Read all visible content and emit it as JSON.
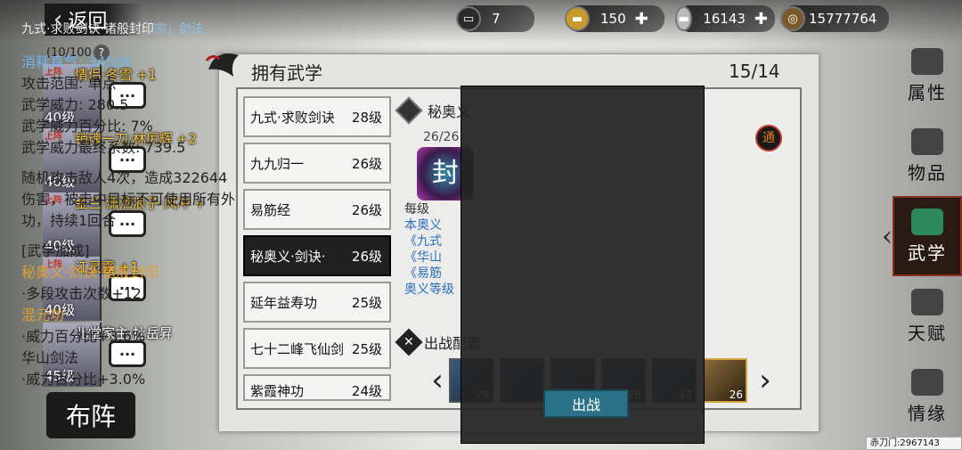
{
  "topbar": {
    "back_label": "返回",
    "resources": [
      {
        "icon": "cart-icon",
        "value": "7",
        "has_plus": false
      },
      {
        "icon": "gold-ingot-icon",
        "value": "150",
        "has_plus": true
      },
      {
        "icon": "silver-ingot-icon",
        "value": "16143",
        "has_plus": true
      },
      {
        "icon": "coin-icon",
        "value": "15777764",
        "has_plus": false
      }
    ]
  },
  "roster": {
    "count": "(10/100",
    "help": "?",
    "heroes": [
      {
        "deploy": "上阵",
        "name": "情侣·冬雪 +1",
        "level": "40级"
      },
      {
        "deploy": "上阵",
        "name": "销魂一刀·林厉辉 +2",
        "level": "40级"
      },
      {
        "deploy": "上阵",
        "name": "金兰·潇洒浪子·风冲 +",
        "level": "40级"
      },
      {
        "deploy": "上阵",
        "name": "江灵露 +1",
        "level": "40级"
      },
      {
        "deploy": "",
        "name": "北堂家主·杜岳昇",
        "level": "45级"
      }
    ],
    "chat_glyph": "···",
    "formation_label": "布阵"
  },
  "panel": {
    "title": "拥有武学",
    "page": "15/14",
    "skills": [
      {
        "name": "九式·求败剑诀",
        "level": "28级"
      },
      {
        "name": "九九归一",
        "level": "26级"
      },
      {
        "name": "易筋经",
        "level": "26级"
      },
      {
        "name": "秘奥义·剑诀·",
        "level": "26级"
      },
      {
        "name": "延年益寿功",
        "level": "25级"
      },
      {
        "name": "七十二峰飞仙剑",
        "level": "25级"
      },
      {
        "name": "紫霞神功",
        "level": "24级"
      }
    ],
    "detail": {
      "name": "秘奥义",
      "progress": "26/26",
      "art_char": "封",
      "tong": "通",
      "lines": [
        {
          "text": "每级",
          "cls": ""
        },
        {
          "text": "本奥义",
          "cls": "blue"
        },
        {
          "text": "《九式",
          "cls": "blue"
        },
        {
          "text": "《华山",
          "cls": "blue"
        },
        {
          "text": "《易筋",
          "cls": "blue"
        },
        {
          "text": "奥义等级",
          "cls": "blue"
        }
      ]
    },
    "battle_title": "出战配置",
    "slots": [
      "29",
      "",
      "",
      "28",
      "24",
      "26"
    ]
  },
  "tooltip": {
    "title": "九式·求败剑诀·诸般封印",
    "title_tag": "宗」剑法",
    "lines": [
      {
        "text": "消耗真气: 34500",
        "cls": "blue"
      },
      {
        "text": "攻击范围: 单点",
        "cls": ""
      },
      {
        "text": "武学威力: 280.5",
        "cls": ""
      },
      {
        "text": "武学威力百分比: 7%",
        "cls": ""
      },
      {
        "text": "武学威力最终系数: 739.5",
        "cls": ""
      },
      {
        "text": "",
        "cls": "gap"
      },
      {
        "text": "随机攻击敌人4次，造成322644伤害，被击中目标不可使用所有外功，持续1回合",
        "cls": ""
      },
      {
        "text": "",
        "cls": "gap"
      },
      {
        "text": "[武学加成]",
        "cls": ""
      },
      {
        "text": "秘奥义·剑诀·诸般封印",
        "cls": "orange"
      },
      {
        "text": "·多段攻击次数+12",
        "cls": ""
      },
      {
        "text": "混元功",
        "cls": "orange"
      },
      {
        "text": "·威力百分比+3.6%",
        "cls": ""
      },
      {
        "text": "华山剑法",
        "cls": ""
      },
      {
        "text": "·威力百分比+3.0%",
        "cls": ""
      }
    ],
    "fight_label": "出战"
  },
  "sidenav": [
    {
      "label": "属性",
      "icon": "attribute-icon",
      "active": false
    },
    {
      "label": "物品",
      "icon": "item-icon",
      "active": false
    },
    {
      "label": "武学",
      "icon": "martial-arts-icon",
      "active": true
    },
    {
      "label": "天赋",
      "icon": "talent-icon",
      "active": false
    },
    {
      "label": "情缘",
      "icon": "bond-icon",
      "active": false
    }
  ],
  "footer": {
    "sect_id": "赤刀门:2967143"
  }
}
